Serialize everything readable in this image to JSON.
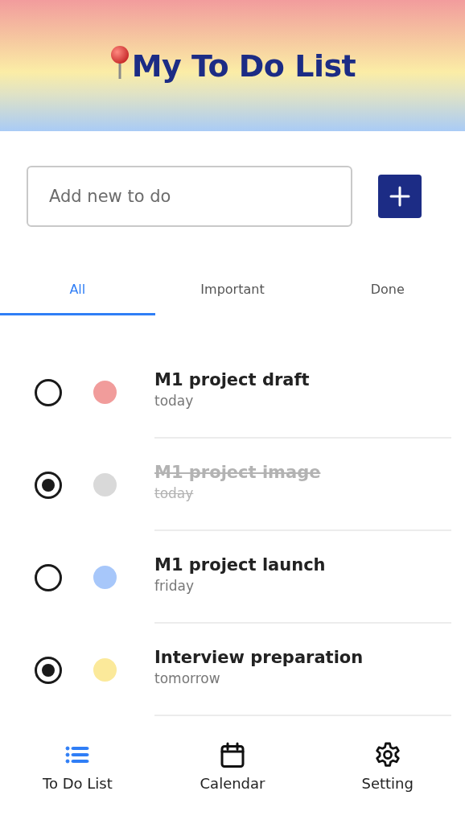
{
  "header": {
    "title": "My To Do List"
  },
  "new_todo": {
    "placeholder": "Add new to do"
  },
  "tabs": [
    {
      "label": "All",
      "selected": true
    },
    {
      "label": "Important",
      "selected": false
    },
    {
      "label": "Done",
      "selected": false
    }
  ],
  "todos": [
    {
      "title": "M1 project draft",
      "due": "today",
      "checked": false,
      "done": false,
      "color": "#f19c9b"
    },
    {
      "title": "M1 project image",
      "due": "today",
      "checked": true,
      "done": true,
      "color": "#d9d9d9"
    },
    {
      "title": "M1 project launch",
      "due": "friday",
      "checked": false,
      "done": false,
      "color": "#a7c7fa"
    },
    {
      "title": "Interview preparation",
      "due": "tomorrow",
      "checked": true,
      "done": false,
      "color": "#fbe99a"
    }
  ],
  "nav": [
    {
      "kind": "list",
      "label": "To Do List",
      "selected": true
    },
    {
      "kind": "calendar",
      "label": "Calendar",
      "selected": false
    },
    {
      "kind": "settings",
      "label": "Setting",
      "selected": false
    }
  ]
}
